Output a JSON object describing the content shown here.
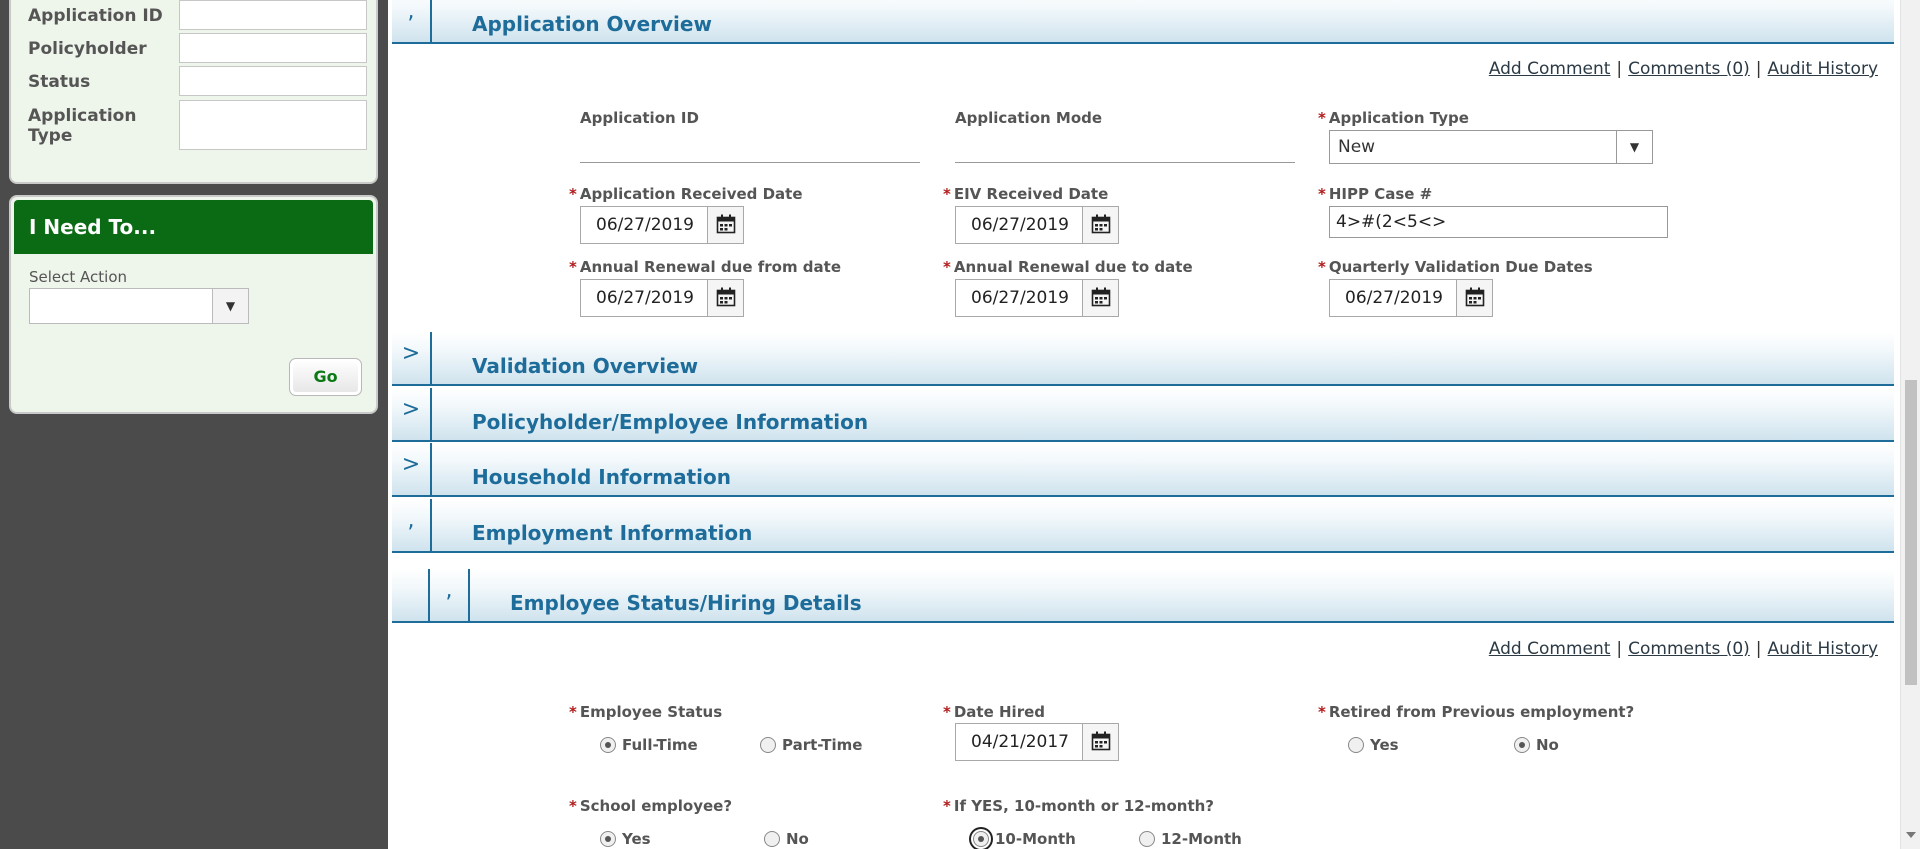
{
  "search_panel": {
    "fields": [
      {
        "label": "Application ID",
        "value": ""
      },
      {
        "label": "Policyholder",
        "value": ""
      },
      {
        "label": "Status",
        "value": ""
      },
      {
        "label": "Application Type",
        "value": ""
      }
    ]
  },
  "action_panel": {
    "header": "I Need To...",
    "select_label": "Select Action",
    "select_value": "",
    "go_label": "Go"
  },
  "links": {
    "add_comment": "Add Comment",
    "comments": "Comments (0)",
    "audit_history": "Audit History",
    "separator": "|"
  },
  "sections": {
    "application_overview": {
      "toggle": ",",
      "title": "Application Overview"
    },
    "validation_overview": {
      "toggle": ">",
      "title": "Validation Overview"
    },
    "policyholder_employee": {
      "toggle": ">",
      "title": "Policyholder/Employee Information"
    },
    "household": {
      "toggle": ">",
      "title": "Household Information"
    },
    "employment": {
      "toggle": ",",
      "title": "Employment Information"
    },
    "employee_status": {
      "toggle": ",",
      "title": "Employee Status/Hiring Details"
    }
  },
  "overview_form": {
    "application_id": {
      "label": "Application ID",
      "value": ""
    },
    "application_mode": {
      "label": "Application Mode",
      "value": ""
    },
    "application_type": {
      "label": "Application Type",
      "value": "New"
    },
    "application_received_date": {
      "label": "Application Received Date",
      "value": "06/27/2019"
    },
    "eiv_received_date": {
      "label": "EIV Received Date",
      "value": "06/27/2019"
    },
    "hipp_case": {
      "label": "HIPP Case #",
      "value": "4>#(2<5<>"
    },
    "annual_renewal_from": {
      "label": "Annual Renewal due from date",
      "value": "06/27/2019"
    },
    "annual_renewal_to": {
      "label": "Annual Renewal due to date",
      "value": "06/27/2019"
    },
    "quarterly_validation": {
      "label": "Quarterly Validation Due Dates",
      "value": "06/27/2019"
    }
  },
  "employment_form": {
    "employee_status": {
      "label": "Employee Status",
      "options": [
        "Full-Time",
        "Part-Time"
      ],
      "selected": "Full-Time"
    },
    "date_hired": {
      "label": "Date Hired",
      "value": "04/21/2017"
    },
    "retired": {
      "label": "Retired from Previous employment?",
      "options": [
        "Yes",
        "No"
      ],
      "selected": "No"
    },
    "school_employee": {
      "label": "School employee?",
      "options": [
        "Yes",
        "No"
      ],
      "selected": "Yes"
    },
    "month_type": {
      "label": "If YES, 10-month or 12-month?",
      "options": [
        "10-Month",
        "12-Month"
      ],
      "selected": "10-Month"
    }
  },
  "required_marker": "*",
  "icons": {
    "calendar": "calendar-icon",
    "dropdown": "chevron-down-icon"
  }
}
